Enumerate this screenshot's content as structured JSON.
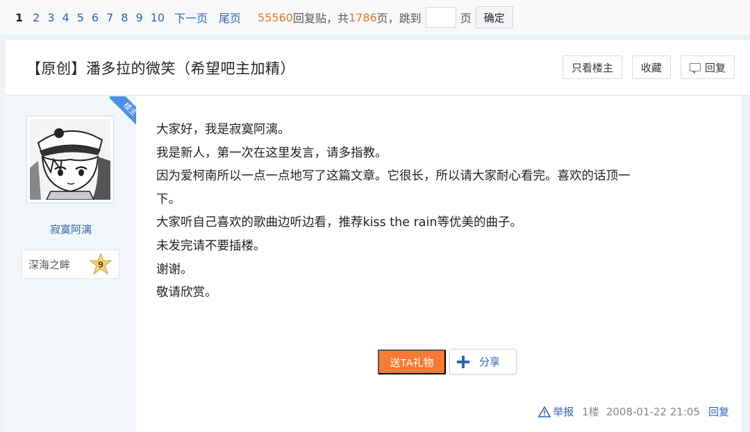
{
  "pager": {
    "current": "1",
    "pages": [
      "2",
      "3",
      "4",
      "5",
      "6",
      "7",
      "8",
      "9",
      "10"
    ],
    "next_label": "下一页",
    "last_label": "尾页",
    "reply_count": "55560",
    "reply_label": "回复贴，共",
    "page_count": "1786",
    "page_jump_label": "页，跳到",
    "page_unit": "页",
    "jump_value": "",
    "confirm_label": "确定"
  },
  "thread": {
    "title": "【原创】潘多拉的微笑（希望吧主加精）",
    "buttons": {
      "only_op": "只看楼主",
      "favorite": "收藏",
      "reply": "回复"
    }
  },
  "author": {
    "badge": "楼主",
    "username": "寂寞阿漓",
    "level_name": "深海之眸",
    "level": "9"
  },
  "post": {
    "lines": [
      "大家好，我是寂寞阿漓。",
      "我是新人，第一次在这里发言，请多指教。",
      "因为爱柯南所以一点一点地写了这篇文章。它很长，所以请大家耐心看完。喜欢的话顶一",
      "下。",
      "大家听自己喜欢的歌曲边听边看，推荐kiss the rain等优美的曲子。",
      "未发完请不要插楼。",
      "谢谢。",
      "敬请欣赏。"
    ],
    "gift_label": "送TA礼物",
    "share_label": "分享",
    "report_label": "举报",
    "floor": "1楼",
    "timestamp": "2008-01-22 21:05",
    "reply_label": "回复"
  },
  "colors": {
    "link": "#2d64b3",
    "accent_orange": "#f57b34",
    "count_orange": "#e07b2a",
    "badge_blue": "#4a90e2"
  }
}
